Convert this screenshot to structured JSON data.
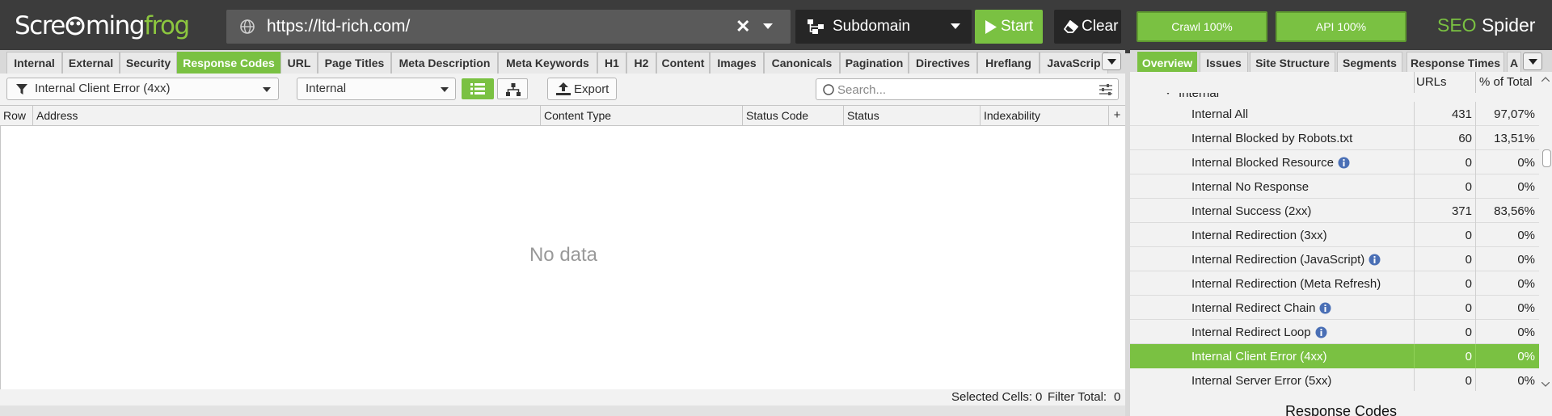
{
  "app": {
    "logo": {
      "part1": "Scre",
      "part2": "ming",
      "part3": "frog"
    },
    "brand": {
      "seo": "SEO",
      "spider": "Spider"
    }
  },
  "toolbar": {
    "url": "https://ltd-rich.com/",
    "mode_label": "Subdomain",
    "start_label": "Start",
    "clear_label": "Clear",
    "crawl_progress_label": "Crawl 100%",
    "crawl_progress": 100,
    "api_progress_label": "API 100%",
    "api_progress": 100
  },
  "tabs": [
    "Internal",
    "External",
    "Security",
    "Response Codes",
    "URL",
    "Page Titles",
    "Meta Description",
    "Meta Keywords",
    "H1",
    "H2",
    "Content",
    "Images",
    "Canonicals",
    "Pagination",
    "Directives",
    "Hreflang",
    "JavaScrip"
  ],
  "active_tab": "Response Codes",
  "filter": {
    "selected": "Internal Client Error (4xx)",
    "scope": "Internal",
    "export_label": "Export",
    "search_placeholder": "Search..."
  },
  "table": {
    "columns": [
      "Row",
      "Address",
      "Content Type",
      "Status Code",
      "Status",
      "Indexability"
    ],
    "add_column_glyph": "+",
    "empty_text": "No data"
  },
  "status": {
    "selected_cells_label": "Selected Cells:",
    "selected_cells": "0",
    "filter_total_label": "Filter Total:",
    "filter_total": "0"
  },
  "right_tabs": [
    "Overview",
    "Issues",
    "Site Structure",
    "Segments",
    "Response Times",
    "A"
  ],
  "right_active_tab": "Overview",
  "overview": {
    "columns": {
      "urls": "URLs",
      "pct": "% of Total"
    },
    "group_label": "Internal",
    "rows": [
      {
        "name": "Internal All",
        "count": "431",
        "pct": "97,07%",
        "info": false
      },
      {
        "name": "Internal Blocked by Robots.txt",
        "count": "60",
        "pct": "13,51%",
        "info": false
      },
      {
        "name": "Internal Blocked Resource",
        "count": "0",
        "pct": "0%",
        "info": true
      },
      {
        "name": "Internal No Response",
        "count": "0",
        "pct": "0%",
        "info": false
      },
      {
        "name": "Internal Success (2xx)",
        "count": "371",
        "pct": "83,56%",
        "info": false
      },
      {
        "name": "Internal Redirection (3xx)",
        "count": "0",
        "pct": "0%",
        "info": false
      },
      {
        "name": "Internal Redirection (JavaScript)",
        "count": "0",
        "pct": "0%",
        "info": true
      },
      {
        "name": "Internal Redirection (Meta Refresh)",
        "count": "0",
        "pct": "0%",
        "info": false
      },
      {
        "name": "Internal Redirect Chain",
        "count": "0",
        "pct": "0%",
        "info": true
      },
      {
        "name": "Internal Redirect Loop",
        "count": "0",
        "pct": "0%",
        "info": true
      },
      {
        "name": "Internal Client Error (4xx)",
        "count": "0",
        "pct": "0%",
        "info": false
      },
      {
        "name": "Internal Server Error (5xx)",
        "count": "0",
        "pct": "0%",
        "info": false
      }
    ],
    "selected_row": "Internal Client Error (4xx)",
    "chart_title": "Response Codes"
  },
  "colors": {
    "accent": "#7ac142",
    "topbar": "#3c3c3c",
    "info": "#4a6fb5"
  }
}
